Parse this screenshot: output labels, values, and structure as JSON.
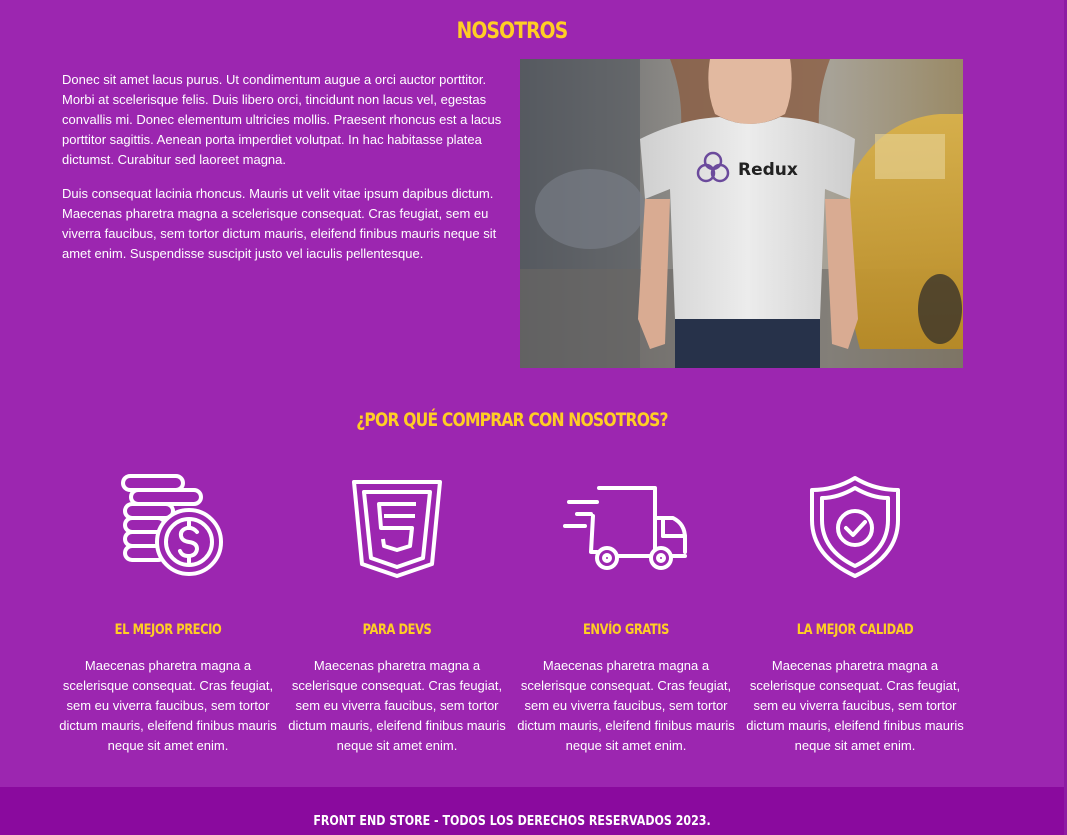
{
  "about": {
    "title": "NOSOTROS",
    "paragraphs": [
      "Donec sit amet lacus purus. Ut condimentum augue a orci auctor porttitor. Morbi at scelerisque felis. Duis libero orci, tincidunt non lacus vel, egestas convallis mi. Donec elementum ultricies mollis. Praesent rhoncus est a lacus porttitor sagittis. Aenean porta imperdiet volutpat. In hac habitasse platea dictumst. Curabitur sed laoreet magna.",
      "Duis consequat lacinia rhoncus. Mauris ut velit vitae ipsum dapibus dictum. Maecenas pharetra magna a scelerisque consequat. Cras feugiat, sem eu viverra faucibus, sem tortor dictum mauris, eleifend finibus mauris neque sit amet enim. Suspendisse suscipit justo vel iaculis pellentesque."
    ],
    "image": {
      "shirt_brand": "Redux"
    }
  },
  "why": {
    "title": "¿POR QUÉ COMPRAR CON NOSOTROS?",
    "features": [
      {
        "icon": "coins-dollar-icon",
        "title": "EL MEJOR PRECIO",
        "text": "Maecenas pharetra magna a scelerisque consequat. Cras feugiat, sem eu viverra faucibus, sem tortor dictum mauris, eleifend finibus mauris neque sit amet enim."
      },
      {
        "icon": "html5-icon",
        "title": "PARA DEVS",
        "text": "Maecenas pharetra magna a scelerisque consequat. Cras feugiat, sem eu viverra faucibus, sem tortor dictum mauris, eleifend finibus mauris neque sit amet enim."
      },
      {
        "icon": "delivery-truck-icon",
        "title": "ENVÍO GRATIS",
        "text": "Maecenas pharetra magna a scelerisque consequat. Cras feugiat, sem eu viverra faucibus, sem tortor dictum mauris, eleifend finibus mauris neque sit amet enim."
      },
      {
        "icon": "shield-check-icon",
        "title": "LA MEJOR CALIDAD",
        "text": "Maecenas pharetra magna a scelerisque consequat. Cras feugiat, sem eu viverra faucibus, sem tortor dictum mauris, eleifend finibus mauris neque sit amet enim."
      }
    ]
  },
  "footer": {
    "text": "FRONT END STORE - TODOS LOS DERECHOS RESERVADOS 2023."
  },
  "colors": {
    "background": "#9c26b0",
    "heading": "#ffce24",
    "footer": "#8a0a9e",
    "text": "#ffffff"
  }
}
